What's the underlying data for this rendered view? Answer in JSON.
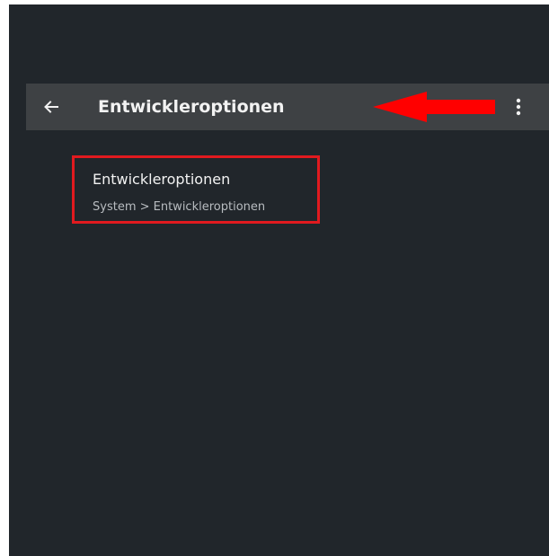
{
  "toolbar": {
    "back_icon": "arrow-left-icon",
    "title": "Entwickleroptionen",
    "more_icon": "more-vertical-icon"
  },
  "annotation": {
    "arrow_color": "#ff0000",
    "highlight_color": "#e11a1f"
  },
  "results": [
    {
      "title": "Entwickleroptionen",
      "path": "System > Entwickleroptionen"
    }
  ],
  "colors": {
    "background": "#21262b",
    "toolbar": "#3e4144",
    "text_primary": "#f2f2f2",
    "text_secondary": "#b8bcc0"
  }
}
